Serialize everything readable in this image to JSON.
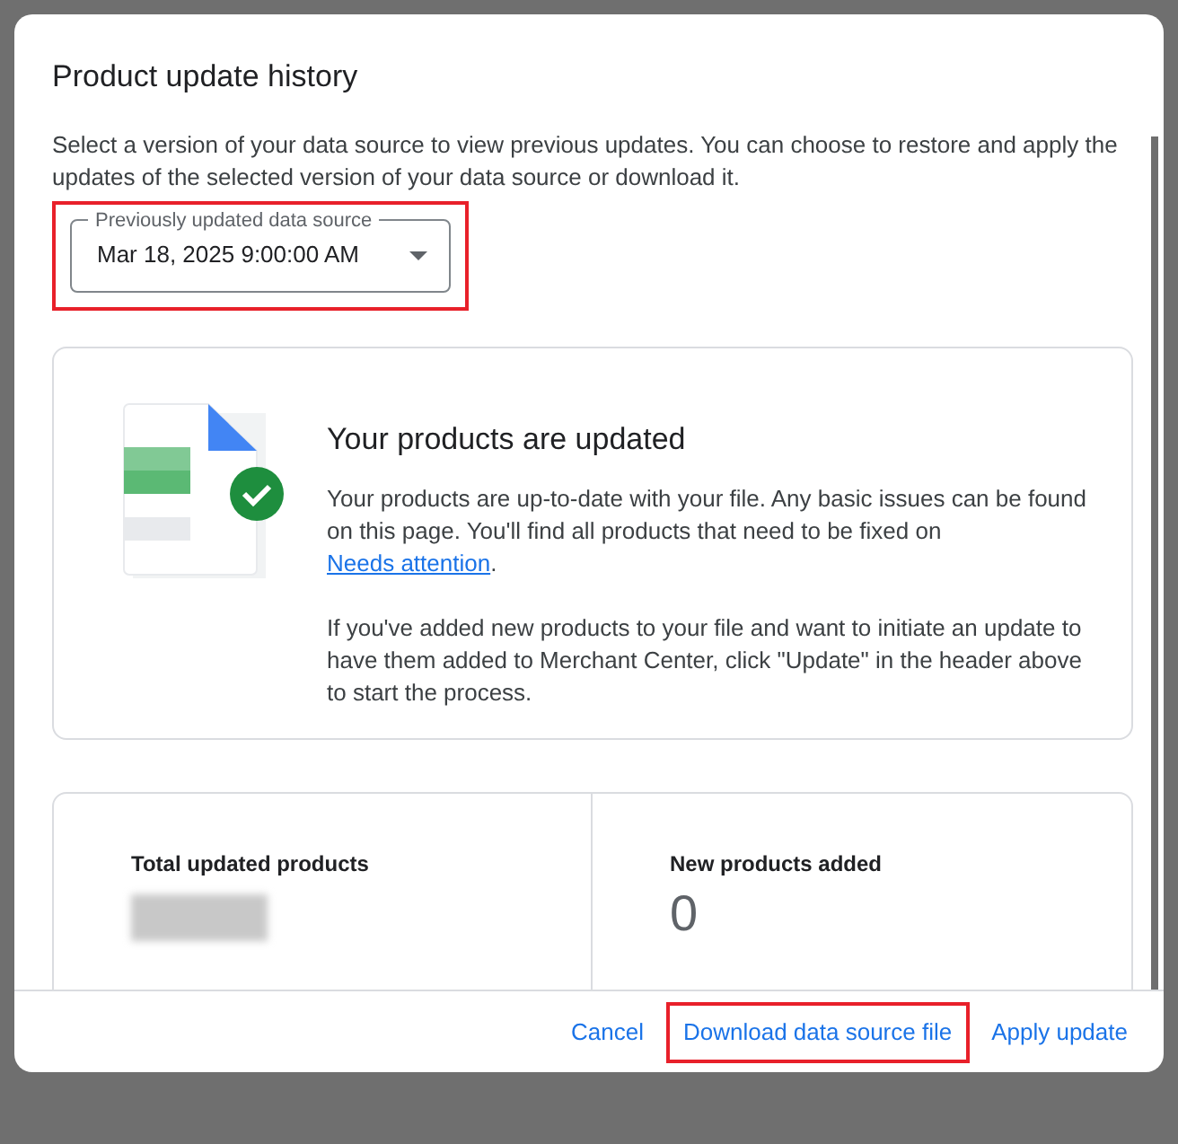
{
  "dialog": {
    "title": "Product update history",
    "description": "Select a version of your data source to view previous updates. You can choose to restore and apply the updates of the selected version of your data source or download it.",
    "version_select": {
      "label": "Previously updated data source",
      "value": "Mar 18, 2025 9:00:00 AM",
      "highlighted": true
    },
    "status_card": {
      "heading": "Your products are updated",
      "paragraph_1": "Your products are up-to-date with your file. Any basic issues can be found on this page. You'll find all products that need to be fixed on ",
      "link": "Needs attention",
      "paragraph_1_end": ".",
      "paragraph_2": "If you've added new products to your file and want to initiate an update to have them added to Merchant Center, click \"Update\" in the header above to start the process."
    },
    "stats": [
      {
        "label": "Total updated products",
        "redacted": true
      },
      {
        "label": "New products added",
        "value": "0",
        "redacted": false
      }
    ],
    "buttons": [
      {
        "label": "Cancel",
        "highlighted": false
      },
      {
        "label": "Download data source file",
        "highlighted": true
      },
      {
        "label": "Apply update",
        "highlighted": false
      }
    ]
  }
}
